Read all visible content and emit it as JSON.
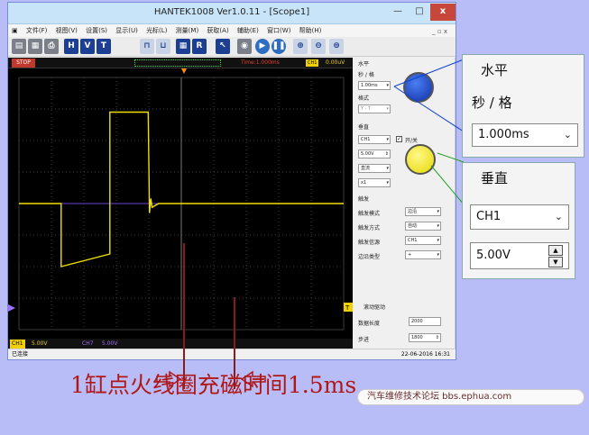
{
  "window": {
    "title": "HANTEK1008 Ver1.0.11 - [Scope1]",
    "min_label": "—",
    "max_label": "□",
    "close_label": "x"
  },
  "menubar": {
    "items": [
      "文件(F)",
      "视图(V)",
      "设置(S)",
      "显示(U)",
      "光标(L)",
      "测量(M)",
      "获取(A)",
      "辅助(E)",
      "窗口(W)",
      "帮助(H)"
    ],
    "window_controls": "_ ▫ x"
  },
  "toolbar": {
    "buttons": [
      "H",
      "V",
      "T",
      "R"
    ]
  },
  "scope": {
    "status": "STOP",
    "time_div": "Time:1.000ms",
    "ch1_tag": "CH1",
    "trigger_voltage": "0.00uV",
    "trigger_marker": "T",
    "ch1_bottom": "CH1",
    "ch1_bottom_value": "5.00V",
    "ch7_bottom": "CH7",
    "ch7_bottom_value": "5.00V"
  },
  "panel": {
    "horizontal_label": "水平",
    "sec_div_label": "秒 / 格",
    "sec_div_value": "1.00ms",
    "format_label": "格式",
    "format_value": "Y - T",
    "vertical_label": "垂直",
    "channel_value": "CH1",
    "onoff_label": "开/关",
    "volt_value": "5.00V",
    "coupling_value": "直流",
    "probe_value": "x1",
    "trigger_label": "触发",
    "trigger_rows": [
      {
        "label": "触发模式",
        "value": "边沿"
      },
      {
        "label": "触发方式",
        "value": "自动"
      },
      {
        "label": "触发信源",
        "value": "CH1"
      },
      {
        "label": "边沿类型",
        "value": "+"
      }
    ],
    "scroll_label": "滚动驱动",
    "storage_depth_label": "数据长度",
    "storage_depth_value": "2000",
    "step_label": "步进",
    "step_value": "1800"
  },
  "statusbar": {
    "left": "已连接",
    "right": "22-06-2016 16:31"
  },
  "zoom_horizontal": {
    "title": "水平",
    "sub": "秒 / 格",
    "value": "1.000ms"
  },
  "zoom_vertical": {
    "title": "垂直",
    "channel": "CH1",
    "volt": "5.00V"
  },
  "annotation": {
    "text": "1缸点火线圈充磁时间1.5ms"
  },
  "watermark": {
    "text": "汽车维修技术论坛 bbs.ephua.com"
  },
  "colors": {
    "ch1_trace": "#f0e000",
    "ch7_trace": "#6a3fd8",
    "annotation": "#b01818"
  },
  "chart_data": {
    "type": "line",
    "title": "",
    "xlabel": "",
    "ylabel": "",
    "x_unit": "ms",
    "y_unit": "V",
    "xlim": [
      -1.3,
      8.7
    ],
    "ylim": [
      -20,
      20
    ],
    "grid": true,
    "grid_divisions": {
      "x": 10,
      "y": 8
    },
    "series": [
      {
        "name": "CH1",
        "x": [
          -1.3,
          0.0,
          0.0,
          1.5,
          1.5,
          2.6,
          2.68,
          2.72,
          2.76,
          2.8,
          3.0,
          8.7
        ],
        "y": [
          0,
          0,
          -10,
          -8,
          14.5,
          14.5,
          14.5,
          -1.5,
          0.8,
          -0.6,
          0,
          0
        ]
      },
      {
        "name": "CH7",
        "x": [
          -1.3,
          8.7
        ],
        "y": [
          0,
          0
        ]
      }
    ]
  }
}
